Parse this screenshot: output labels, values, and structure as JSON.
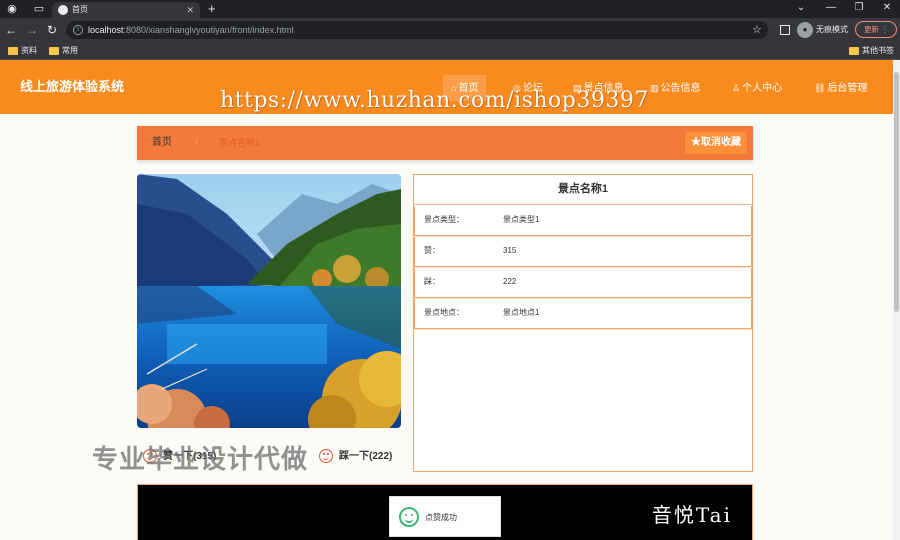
{
  "browser": {
    "tab_title": "首页",
    "url_host": "localhost",
    "url_rest": ":8080/xianshanglvyoutiyan/front/index.html",
    "incognito_label": "无痕模式",
    "update_label": "更新",
    "bookmarks": [
      "资料",
      "常用"
    ],
    "other_bookmarks": "其他书签"
  },
  "header": {
    "site_title": "线上旅游体验系统",
    "nav": [
      {
        "label": "首页",
        "icon": "home-icon"
      },
      {
        "label": "论坛",
        "icon": "forum-icon"
      },
      {
        "label": "景点信息",
        "icon": "scenic-icon"
      },
      {
        "label": "公告信息",
        "icon": "notice-icon"
      },
      {
        "label": "个人中心",
        "icon": "user-icon"
      },
      {
        "label": "后台管理",
        "icon": "link-icon"
      }
    ]
  },
  "watermark_url": "https://www.huzhan.com/ishop39397",
  "breadcrumb": {
    "home": "首页",
    "separator": "/",
    "current": "景点名称1"
  },
  "favorite_button": "取消收藏",
  "detail": {
    "title": "景点名称1",
    "rows": [
      {
        "key": "景点类型：",
        "value": "景点类型1"
      },
      {
        "key": "赞：",
        "value": "315"
      },
      {
        "key": "踩：",
        "value": "222"
      },
      {
        "key": "景点地点：",
        "value": "景点地点1"
      }
    ]
  },
  "votes": {
    "like_label": "赞一下(315)",
    "dislike_label": "踩一下(222)"
  },
  "watermark_cn": "专业毕业设计代做",
  "video_brand": "音悦Tai",
  "toast": "点赞成功",
  "colors": {
    "header": "#f98a1e",
    "breadcrumb": "#f47a3c",
    "accent_border": "#f0a36a",
    "toast_icon": "#3cb371"
  }
}
